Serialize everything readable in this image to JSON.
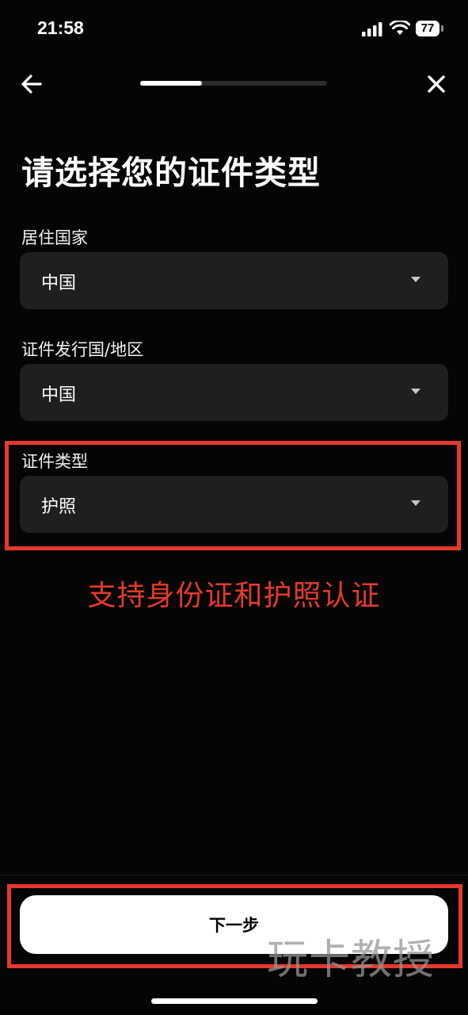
{
  "status_bar": {
    "time": "21:58",
    "battery_level": "77"
  },
  "header": {
    "back_icon": "arrow-left-icon",
    "close_icon": "close-icon",
    "progress": 0.33
  },
  "page_title": "请选择您的证件类型",
  "fields": [
    {
      "label": "居住国家",
      "value": "中国"
    },
    {
      "label": "证件发行国/地区",
      "value": "中国"
    },
    {
      "label": "证件类型",
      "value": "护照"
    }
  ],
  "annotation": "支持身份证和护照认证",
  "next_button": {
    "label": "下一步"
  },
  "watermark": "玩卡教授",
  "colors": {
    "background": "#050505",
    "field_bg": "#1f1f22",
    "highlight": "#e53a2b",
    "button_bg": "#ffffff"
  }
}
